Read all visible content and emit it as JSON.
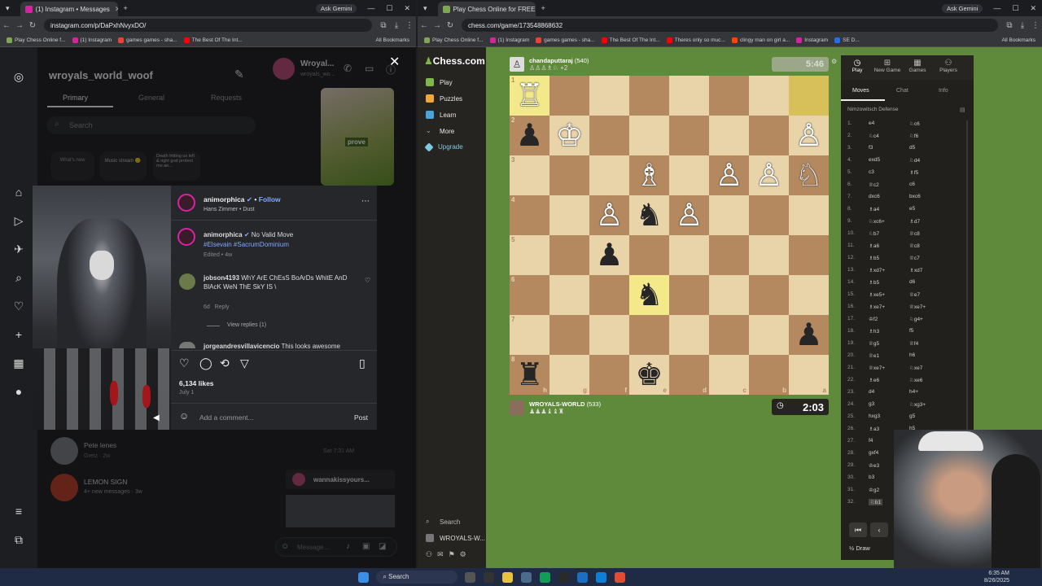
{
  "left_window": {
    "tab_title": "(1) Instagram • Messages",
    "url": "instagram.com/p/DaPxhNvyxDO/",
    "ask_label": "Ask Gemini",
    "bookmarks": [
      "Play Chess Online f...",
      "(1) Instagram",
      "games games - sha...",
      "The Best Of The Int..."
    ],
    "all_bookmarks": "All Bookmarks",
    "window_controls": [
      "—",
      "☐",
      "✕"
    ]
  },
  "instagram": {
    "username": "wroyals_world_woof",
    "tabs": [
      "Primary",
      "General",
      "Requests"
    ],
    "search_placeholder": "Search",
    "notes": [
      {
        "label": "What's new"
      },
      {
        "label": "Music stream 🙂"
      },
      {
        "label": "Death hitting us left & right god protect me an..."
      }
    ],
    "chat_header_name": "Wroyal...",
    "chat_header_sub": "wroyals_wo...",
    "chat_image_label": "prove",
    "post": {
      "author": "animorphica",
      "follow": "Follow",
      "audio": "Hans Zimmer • Dust",
      "caption_text": "No Valid Move",
      "caption_tags": "#Elsevain #SacrumDominium",
      "caption_meta": "Edited • 4w",
      "comment1_user": "jobson4193",
      "comment1_text": "WhY ArE ChEsS BoArDs WhitE AnD BlAcK WeN ThE SkY IS \\",
      "comment1_meta": "6d",
      "reply": "Reply",
      "view_replies": "View replies (1)",
      "comment2_user": "jorgeandresvillavicencio",
      "comment2_text": "This looks awesome",
      "likes": "6,134 likes",
      "date": "July 1",
      "add_comment_placeholder": "Add a comment...",
      "post_button": "Post"
    },
    "conversations": [
      {
        "name": "Pete lenes",
        "sub": "Gretz · 2w",
        "time": "Sat 7:31 AM"
      },
      {
        "name": "LEMON SIGN",
        "sub": "4+ new messages · 3w"
      }
    ],
    "shared_label": "wannakissyours...",
    "message_placeholder": "Message..."
  },
  "right_window": {
    "tab_title": "Play Chess Online for FREE - 2...",
    "url": "chess.com/game/173548868632",
    "ask_label": "Ask Gemini",
    "bookmarks": [
      "Play Chess Online f...",
      "(1) Instagram",
      "games games - sha...",
      "The Best Of The Int...",
      "Theres only so muc...",
      "clingy man on girl a...",
      "Instagram",
      "SE D..."
    ],
    "all_bookmarks": "All Bookmarks"
  },
  "chesscom": {
    "logo": "Chess.com",
    "menu": [
      "Play",
      "Puzzles",
      "Learn",
      "More",
      "Upgrade"
    ],
    "bottom_search": "Search",
    "bottom_user": "WROYALS-W...",
    "opponent": {
      "name": "chandaputtaraj",
      "rating": "(540)",
      "captured": "♙♙♙♗♘ +2",
      "clock": "5:46"
    },
    "player": {
      "name": "WROYALS-WORLD",
      "rating": "(533)",
      "captured": "♟♟♟♝♝♜",
      "clock": "2:03"
    },
    "ranks": [
      "1",
      "2",
      "3",
      "4",
      "5",
      "6",
      "7",
      "8"
    ],
    "files": [
      "h",
      "g",
      "f",
      "e",
      "d",
      "c",
      "b",
      "a"
    ],
    "board": [
      [
        "wR",
        "",
        "",
        "",
        "",
        "",
        "",
        "hl"
      ],
      [
        "bP",
        "wK",
        "",
        "",
        "",
        "",
        "",
        "wP"
      ],
      [
        "",
        "",
        "",
        "wB",
        "",
        "wP",
        "wP",
        "wN"
      ],
      [
        "",
        "",
        "wP",
        "bN",
        "wP",
        "",
        "",
        ""
      ],
      [
        "",
        "",
        "bP",
        "",
        "",
        "",
        "",
        ""
      ],
      [
        "",
        "",
        "",
        "hlbN",
        "",
        "",
        "",
        ""
      ],
      [
        "",
        "",
        "",
        "",
        "",
        "",
        "",
        "bP"
      ],
      [
        "bR",
        "",
        "",
        "bK",
        "",
        "",
        "",
        ""
      ]
    ],
    "top_tabs": [
      "Play",
      "New Game",
      "Games",
      "Players"
    ],
    "sub_tabs": [
      "Moves",
      "Chat",
      "Info"
    ],
    "opening": "Nimzowitsch Defense",
    "moves": [
      [
        "1.",
        "e4",
        "♘c6"
      ],
      [
        "2.",
        "♘c4",
        "♘f6"
      ],
      [
        "3.",
        "f3",
        "d5"
      ],
      [
        "4.",
        "exd5",
        "♘d4"
      ],
      [
        "5.",
        "c3",
        "♗f5"
      ],
      [
        "6.",
        "♕c2",
        "c6"
      ],
      [
        "7.",
        "dxc6",
        "bxc6"
      ],
      [
        "8.",
        "♗a4",
        "e5"
      ],
      [
        "9.",
        "♘xc6+",
        "♗d7"
      ],
      [
        "10.",
        "♘b7",
        "♕c8"
      ],
      [
        "11.",
        "♗a6",
        "♕c8"
      ],
      [
        "12.",
        "♗b5",
        "♕c7"
      ],
      [
        "13.",
        "♗xd7+",
        "♗xd7"
      ],
      [
        "14.",
        "♗b5",
        "d6"
      ],
      [
        "15.",
        "♗xe5+",
        "♕e7"
      ],
      [
        "16.",
        "♗xe7+",
        "♕xe7+"
      ],
      [
        "17.",
        "♔f2",
        "♘g4+"
      ],
      [
        "18.",
        "♗h3",
        "f5"
      ],
      [
        "19.",
        "♕g5",
        "♕f4"
      ],
      [
        "20.",
        "♕e1",
        "h6"
      ],
      [
        "21.",
        "♕xe7+",
        "♘xe7"
      ],
      [
        "22.",
        "♗e6",
        "♘xe6"
      ],
      [
        "23.",
        "d4",
        "h4+"
      ],
      [
        "24.",
        "g3",
        "♘xg3+"
      ],
      [
        "25.",
        "hxg3",
        "g5"
      ],
      [
        "26.",
        "♗a3",
        "h5"
      ],
      [
        "27.",
        "f4",
        "gx..."
      ],
      [
        "28.",
        "gxf4",
        "♔..."
      ],
      [
        "29.",
        "♔e3",
        ""
      ],
      [
        "30.",
        "b3",
        ""
      ],
      [
        "31.",
        "♔g2",
        ""
      ],
      [
        "32.",
        "♘b1",
        ""
      ]
    ],
    "draw_label": "½ Draw"
  },
  "taskbar": {
    "search": "Search",
    "time": "6:35 AM",
    "date": "8/26/2025"
  }
}
